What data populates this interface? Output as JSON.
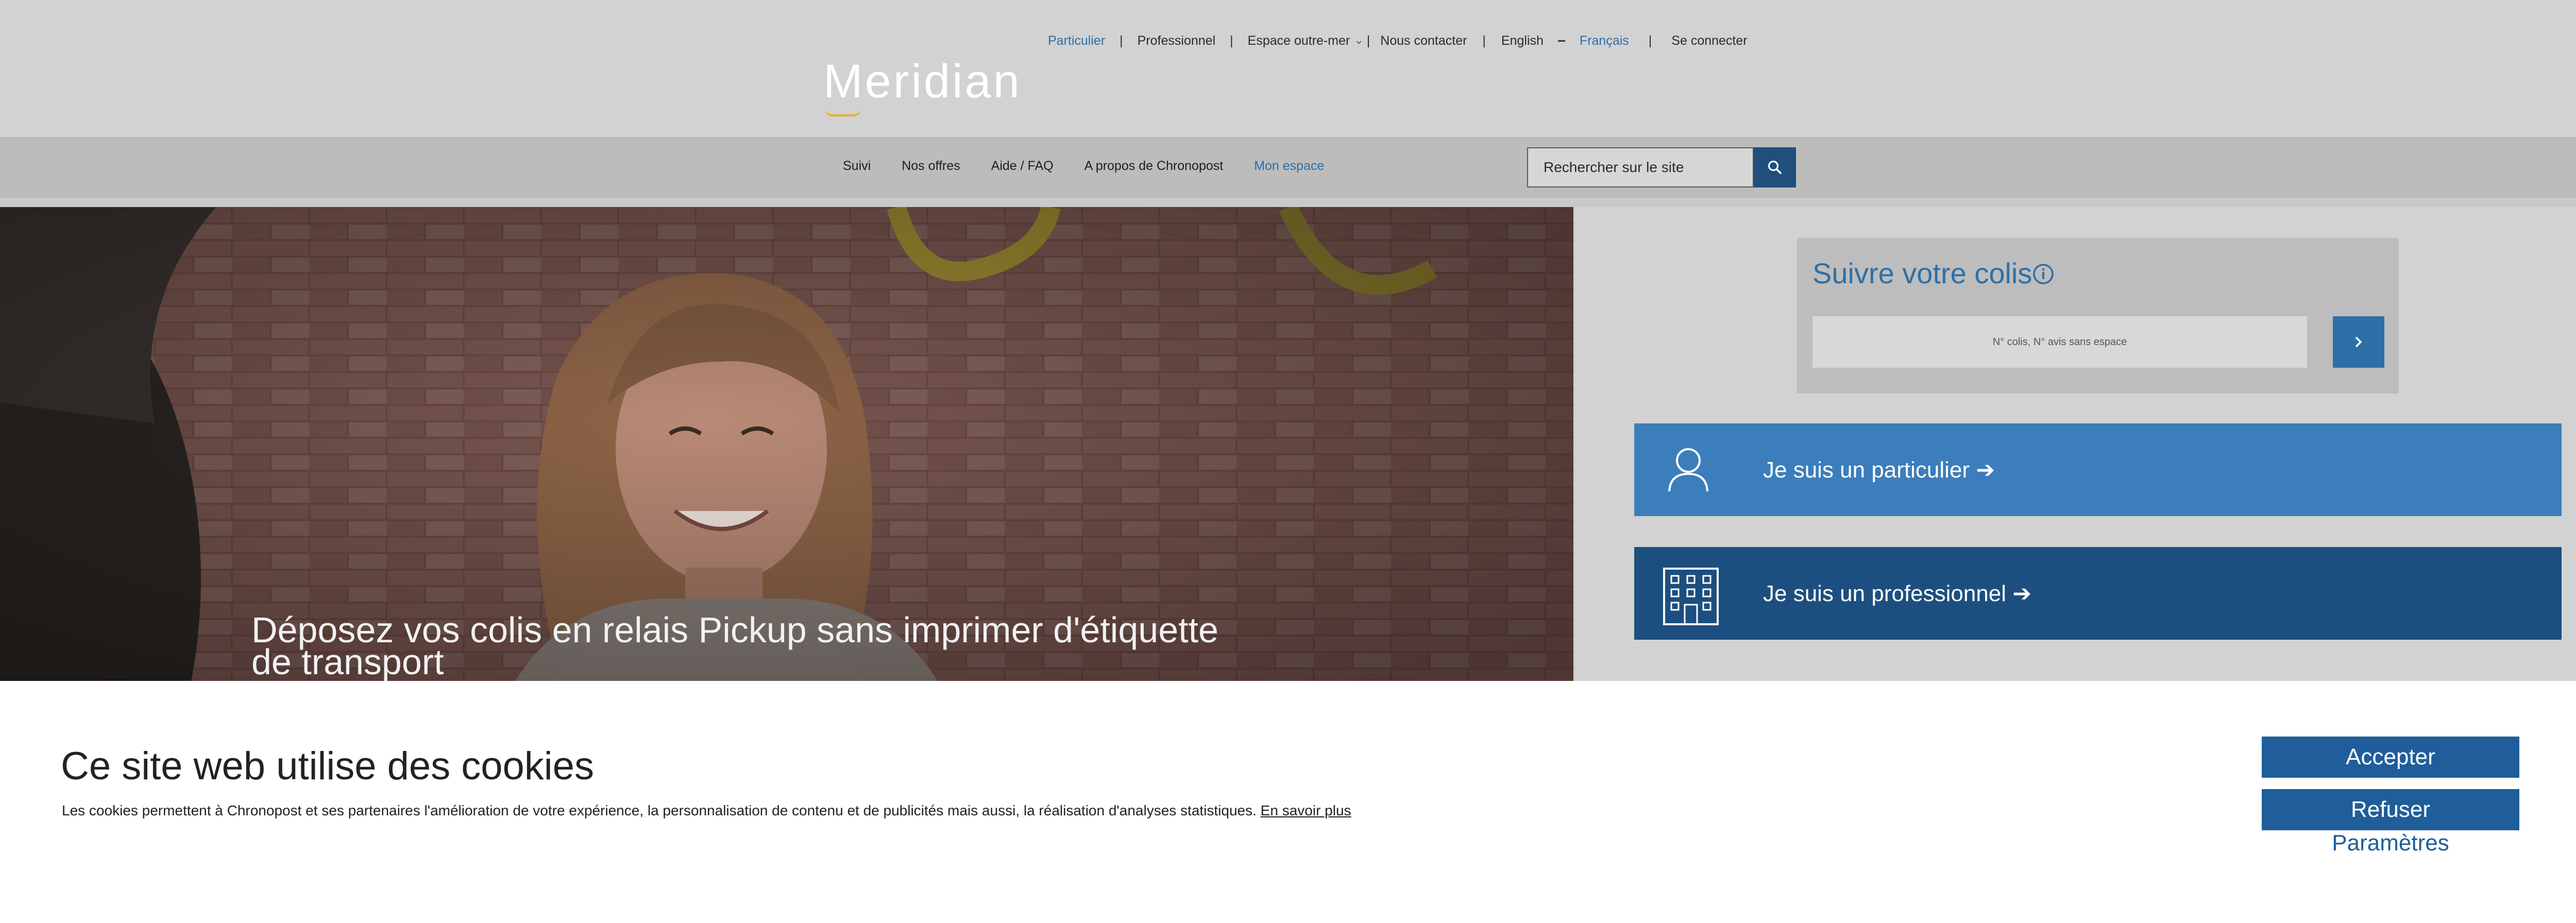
{
  "top_links": {
    "particulier": "Particulier",
    "professionnel": "Professionnel",
    "outremer": "Espace outre-mer",
    "contact": "Nous contacter",
    "english": "English",
    "francais": "Français",
    "login": "Se connecter",
    "separator": "|"
  },
  "logo": {
    "text": "Meridian"
  },
  "nav": {
    "items": [
      "Suivi",
      "Nos offres",
      "Aide / FAQ",
      "A propos de Chronopost",
      "Mon espace"
    ],
    "search_placeholder": "Rechercher sur le site"
  },
  "hero": {
    "caption": "Déposez vos colis en relais Pickup sans imprimer d'étiquette de transport"
  },
  "tracking": {
    "title": "Suivre votre colis",
    "input_placeholder": "N° colis, N° avis sans espace"
  },
  "profiles": {
    "particulier": "Je suis un particulier ➔",
    "professionnel": "Je suis un professionnel ➔"
  },
  "cookies": {
    "title": "Ce site web utilise des cookies",
    "text": "Les cookies permettent à Chronopost et ses partenaires l'amélioration de votre expérience, la personnalisation de contenu et de publicités mais aussi, la réalisation d'analyses statistiques.",
    "link": "En savoir plus",
    "accept": "Accepter",
    "refuse": "Refuser",
    "settings": "Paramètres"
  },
  "colors": {
    "brand_blue": "#2d6fa8",
    "dark_blue": "#1c4f7f",
    "logo_accent": "#e7b21e"
  },
  "icons": [
    "chevron-down-icon",
    "search-icon",
    "info-icon",
    "chevron-right-icon",
    "person-icon",
    "building-icon"
  ]
}
